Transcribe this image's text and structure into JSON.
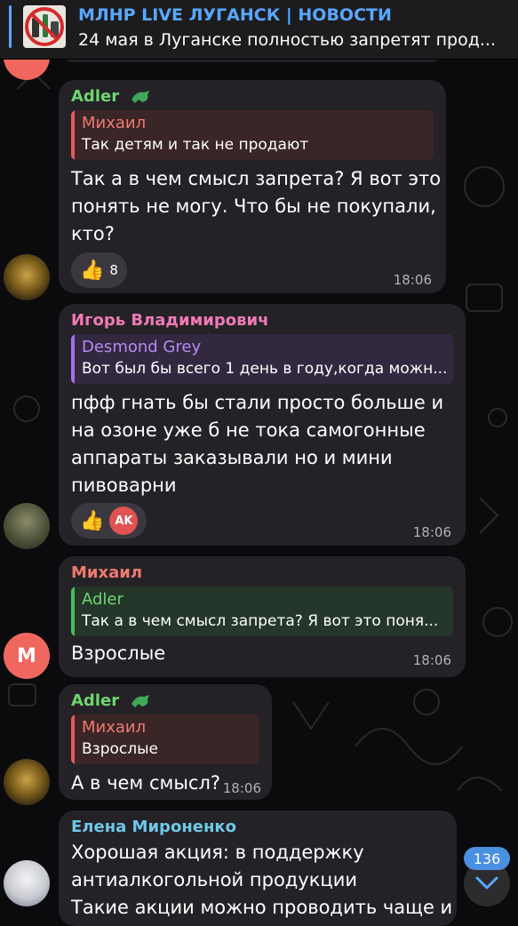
{
  "pinned": {
    "title": "МЛНР LIVE ЛУГАНСК | НОВОСТИ",
    "subtitle": "24 мая в Луганске полностью запретят прод..."
  },
  "messages": [
    {
      "author": "Adler",
      "author_color": "#6fd66f",
      "reply_author": "Михаил",
      "reply_text": "Так детям и так не продают",
      "text_lines": [
        "Так а в чем смысл запрета? Я вот это",
        "понять не могу. Что бы не покупали,",
        "кто?"
      ],
      "reaction_count": "8",
      "time": "18:06"
    },
    {
      "author": "Игорь Владимирович",
      "author_color": "#f07ab5",
      "reply_author": "Desmond Grey",
      "reply_text": "Вот был бы всего 1 день в году,когда можн...",
      "text_lines": [
        "пфф гнать бы стали просто больше и",
        "на озоне уже б не тока самогонные",
        "аппараты заказывали но и мини",
        "пивоварни"
      ],
      "reaction_avatar": "AK",
      "time": "18:06"
    },
    {
      "author": "Михаил",
      "author_color": "#f07a6f",
      "reply_author": "Adler",
      "reply_text": "Так а в чем смысл запрета? Я вот это поня...",
      "text": "Взрослые",
      "time": "18:06",
      "avatar_letter": "M"
    },
    {
      "author": "Adler",
      "author_color": "#6fd66f",
      "reply_author": "Михаил",
      "reply_text": "Взрослые",
      "text": "А в чем смысл?",
      "time": "18:06"
    },
    {
      "author": "Елена Мироненко",
      "author_color": "#6fc8e8",
      "text_lines": [
        "Хорошая акция: в поддержку",
        "антиалкогольной продукции",
        "Такие акции можно проводить чаще и"
      ]
    }
  ],
  "unread_badge": "136"
}
